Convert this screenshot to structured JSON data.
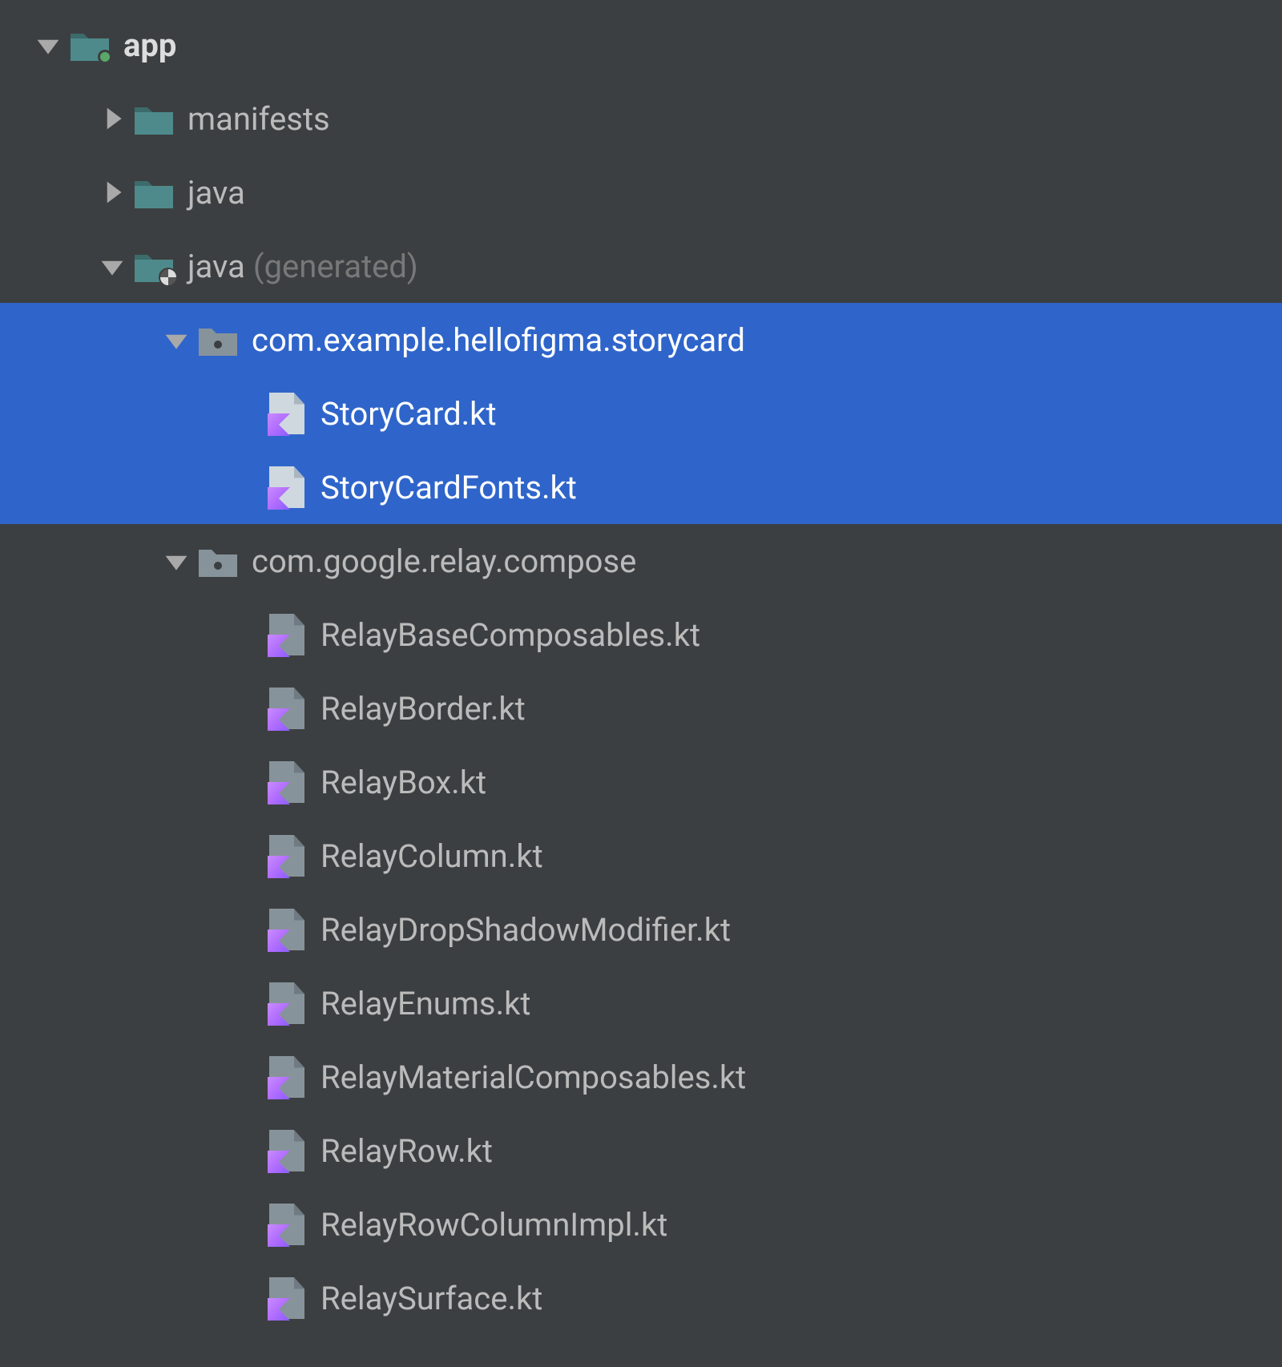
{
  "root": {
    "label": "app"
  },
  "manifests": {
    "label": "manifests"
  },
  "java_src": {
    "label": "java"
  },
  "java_gen": {
    "label": "java",
    "suffix": "(generated)"
  },
  "pkg_storycard": {
    "label": "com.example.hellofigma.storycard"
  },
  "file_storycard": {
    "label": "StoryCard.kt"
  },
  "file_storycardfonts": {
    "label": "StoryCardFonts.kt"
  },
  "pkg_relay": {
    "label": "com.google.relay.compose"
  },
  "relay_files": [
    "RelayBaseComposables.kt",
    "RelayBorder.kt",
    "RelayBox.kt",
    "RelayColumn.kt",
    "RelayDropShadowModifier.kt",
    "RelayEnums.kt",
    "RelayMaterialComposables.kt",
    "RelayRow.kt",
    "RelayRowColumnImpl.kt",
    "RelaySurface.kt"
  ]
}
